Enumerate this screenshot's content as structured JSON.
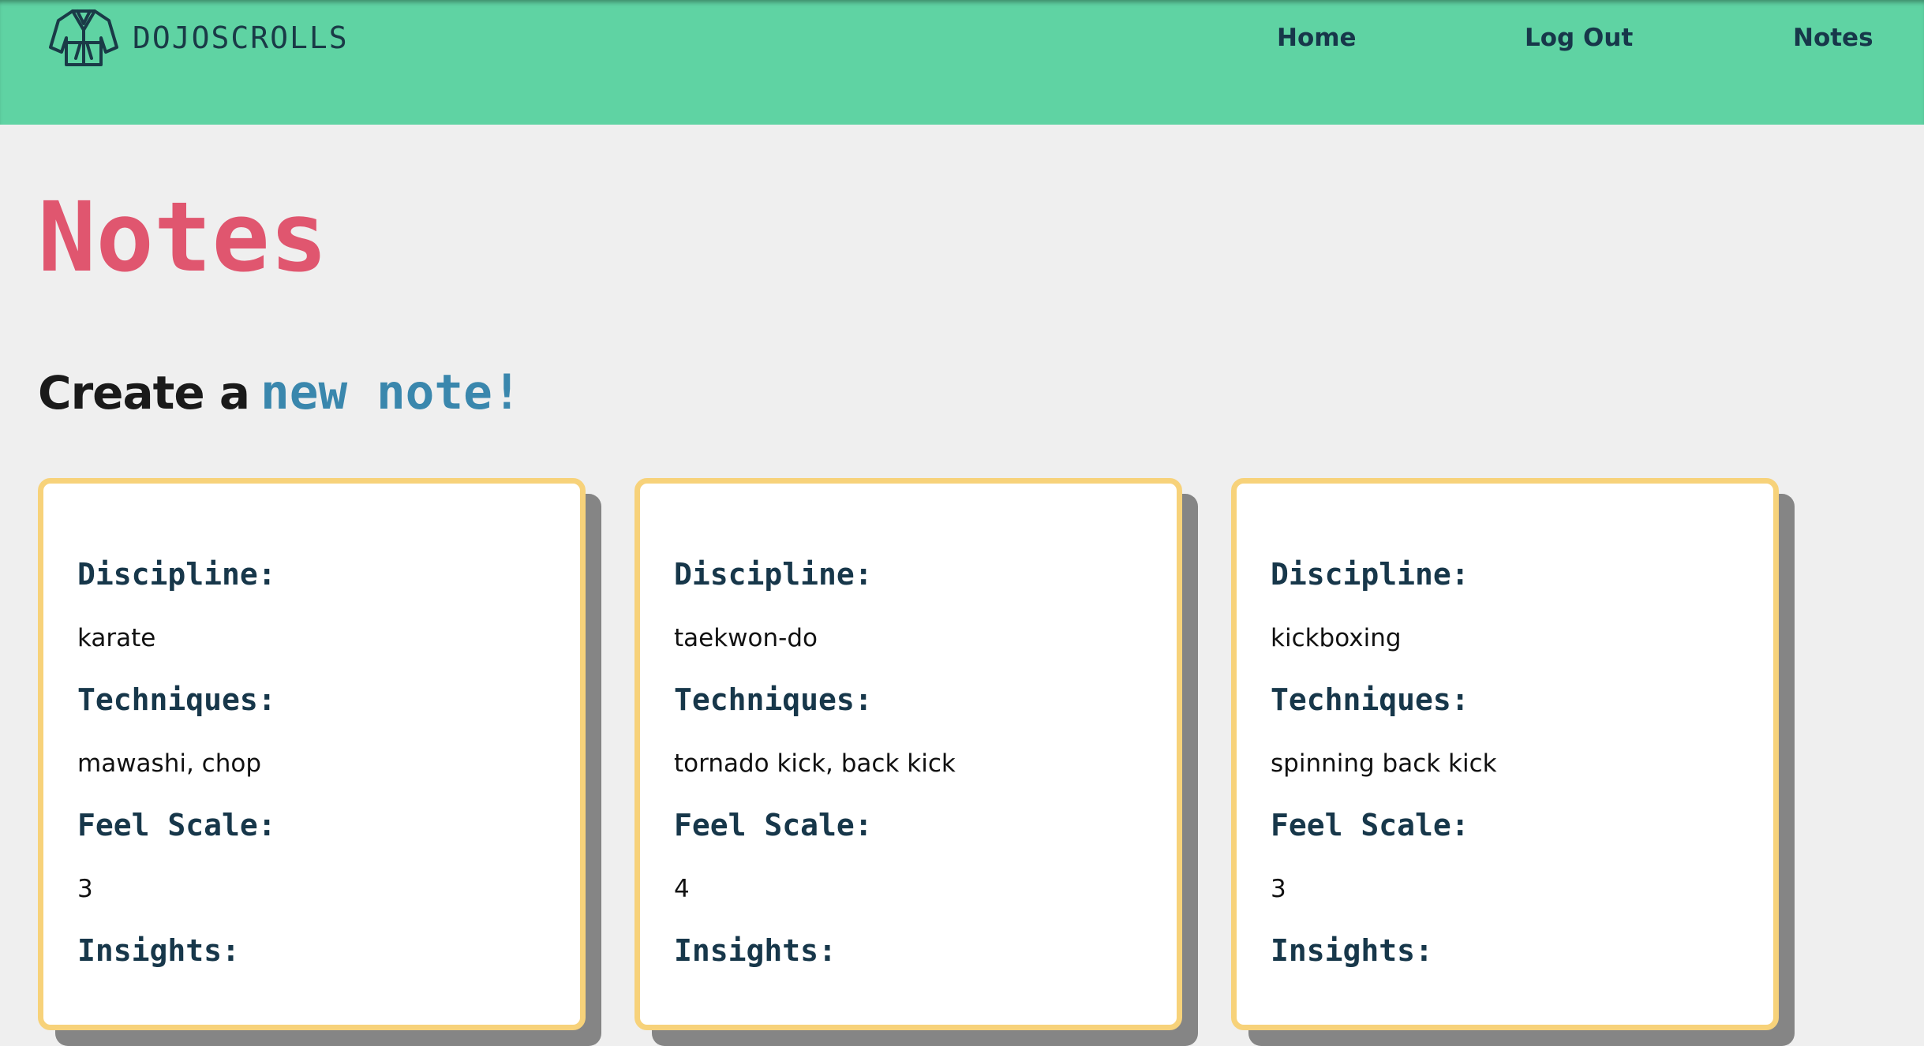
{
  "brand": {
    "name": "DOJOSCROLLS",
    "logo_icon": "gi-uniform-icon"
  },
  "nav": {
    "home": "Home",
    "logout": "Log Out",
    "notes": "Notes"
  },
  "page": {
    "title": "Notes",
    "create_prefix": "Create a",
    "create_link": "new note!"
  },
  "labels": {
    "discipline": "Discipline:",
    "techniques": "Techniques:",
    "feel_scale": "Feel Scale:",
    "insights": "Insights:"
  },
  "notes": [
    {
      "discipline": "karate",
      "techniques": "mawashi, chop",
      "feel_scale": "3"
    },
    {
      "discipline": "taekwon-do",
      "techniques": "tornado kick, back kick",
      "feel_scale": "4"
    },
    {
      "discipline": "kickboxing",
      "techniques": "spinning back kick",
      "feel_scale": "3"
    }
  ],
  "colors": {
    "navbar": "#5fd3a3",
    "title": "#e0566f",
    "link": "#3a87ad",
    "card_border": "#f7d27a",
    "text_dark": "#17374a"
  }
}
